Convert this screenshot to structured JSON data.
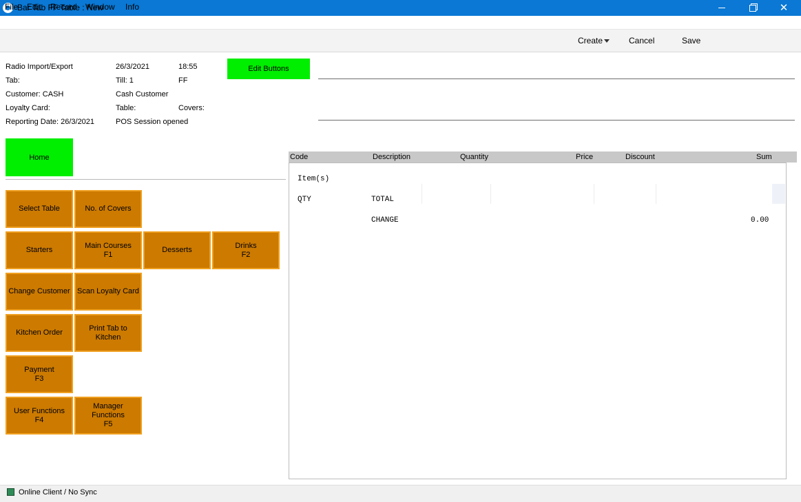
{
  "window": {
    "title": "Bar Tab FF Table : New",
    "close_glyph": "✕"
  },
  "menu": [
    "File",
    "Edit",
    "Record",
    "Window",
    "Info"
  ],
  "toolbar": {
    "create": "Create",
    "cancel": "Cancel",
    "save": "Save"
  },
  "header": {
    "radio": "Radio Import/Export",
    "date": "26/3/2021",
    "time": "18:55",
    "tab_label": "Tab:",
    "till": "Till: 1",
    "ff": "FF",
    "customer": "Customer: CASH",
    "customer_name": "Cash Customer",
    "loyalty": "Loyalty Card:",
    "table": "Table:",
    "covers": "Covers:",
    "reporting_date": "Reporting Date: 26/3/2021",
    "session": "POS Session opened",
    "edit_buttons": "Edit Buttons"
  },
  "home": "Home",
  "buttons": {
    "select_table": "Select Table",
    "no_covers": "No. of  Covers",
    "starters": "Starters",
    "main_courses": "Main Courses\nF1",
    "desserts": "Desserts",
    "drinks": "Drinks\nF2",
    "change_customer": "Change Customer",
    "scan_loyalty": "Scan Loyalty Card",
    "kitchen_order": "Kitchen Order",
    "print_tab": "Print Tab to\nKitchen",
    "payment": "Payment\nF3",
    "user_functions": "User Functions\nF4",
    "manager_functions": "Manager\nFunctions\nF5"
  },
  "receipt": {
    "columns": [
      "Code",
      "Description",
      "Quantity",
      "Price",
      "Discount",
      "Sum"
    ],
    "items_label": "Item(s)",
    "qty": "QTY",
    "total": "TOTAL",
    "change": "CHANGE",
    "change_value": "0.00"
  },
  "status": "Online Client / No Sync",
  "colors": {
    "titlebar": "#0a78d4",
    "green": "#00ee00",
    "button_orange": "#cc7a00",
    "button_border": "#f0a020"
  }
}
